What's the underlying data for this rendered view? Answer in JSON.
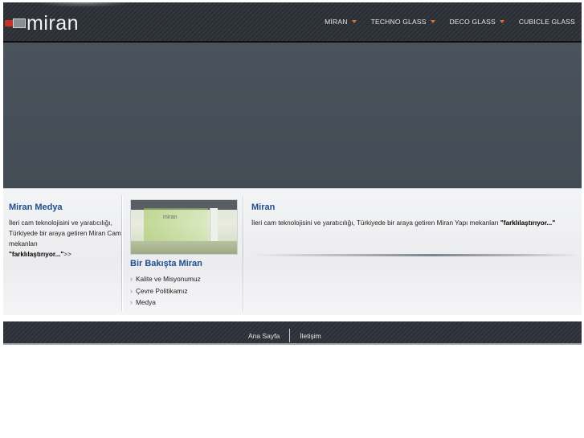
{
  "brand": {
    "name": "miran"
  },
  "nav": {
    "items": [
      {
        "label": "MİRAN",
        "has_dropdown": true
      },
      {
        "label": "TECHNO GLASS",
        "has_dropdown": true
      },
      {
        "label": "DECO GLASS",
        "has_dropdown": true
      },
      {
        "label": "CUBICLE GLASS",
        "has_dropdown": false
      }
    ],
    "arrow_color": "#e1702c"
  },
  "columns": {
    "media": {
      "title": "Miran Medya",
      "text": "İleri cam teknolojisini ve yaratıcılığı, Türkiyede bir araya getiren Miran Cam mekanları",
      "emphasis": "\"farklılaştırıyor...\"",
      "more": ">>"
    },
    "overview": {
      "image_sign": "miran",
      "title": "Bir Bakışta Miran",
      "links": [
        "Kalite ve Misyonumuz",
        "Çevre Politikamız",
        "Medya"
      ]
    },
    "miran": {
      "title": "Miran",
      "text": "İleri cam teknolojisini ve yaratıcılığı, Türkiyede bir araya getiren Miran Yapı mekanları",
      "emphasis": "\"farklılaştırıyor...\""
    }
  },
  "footer": {
    "links": [
      "Ana Sayfa",
      "İletişim"
    ]
  },
  "colors": {
    "heading_blue": "#1e4f8e",
    "banner": "#464f57",
    "header_dark": "#2e3238"
  }
}
